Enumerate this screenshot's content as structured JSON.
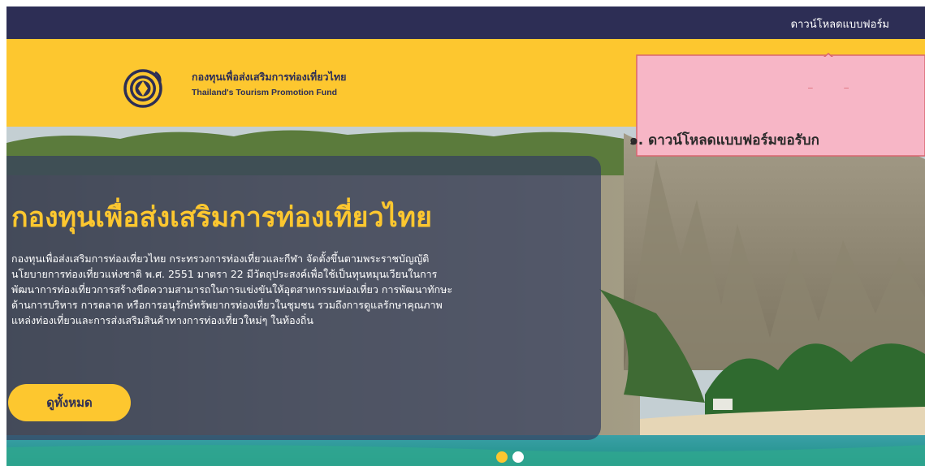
{
  "topbar": {
    "download_link": "ดาวน์โหลดแบบฟอร์ม"
  },
  "header": {
    "logo_title_th": "กองทุนเพื่อส่งเสริมการท่องเที่ยวไทย",
    "logo_title_en": "Thailand's Tourism Promotion Fund"
  },
  "hero": {
    "title": "กองทุนเพื่อส่งเสริมการท่องเที่ยวไทย",
    "description_lines": [
      "กองทุนเพื่อส่งเสริมการท่องเที่ยวไทย กระทรวงการท่องเที่ยวและกีฬา จัดตั้งขึ้นตามพระราชบัญญัติ",
      "นโยบายการท่องเที่ยวแห่งชาติ พ.ศ. 2551 มาตรา 22 มีวัตถุประสงค์เพื่อใช้เป็นทุนหมุนเวียนในการ",
      "พัฒนาการท่องเที่ยวการสร้างขีดความสามารถในการแข่งขันให้อุตสาหกรรมท่องเที่ยว การพัฒนาทักษะ",
      "ด้านการบริหาร การตลาด หรือการอนุรักษ์ทรัพยากรท่องเที่ยวในชุมชน รวมถึงการดูแลรักษาคุณภาพ",
      "แหล่งท่องเที่ยวและการส่งเสริมสินค้าทางการท่องเที่ยวใหม่ๆ ในท้องถิ่น"
    ],
    "view_all_label": "ดูทั้งหมด",
    "slide_count": 2,
    "active_slide": 1
  },
  "annotation": {
    "text": "๑. ดาวน์โหลดแบบฟอร์มขอรับก"
  },
  "colors": {
    "topbar": "#2d2e55",
    "header": "#fdc72f",
    "accent": "#fdc72f",
    "panel": "#343e60",
    "callout_fill": "#f7b6c6",
    "callout_stroke": "#d9656f"
  },
  "icons": {
    "logo": "tourism-fund-logo-icon",
    "callout_arrow": "up-arrow-icon"
  }
}
